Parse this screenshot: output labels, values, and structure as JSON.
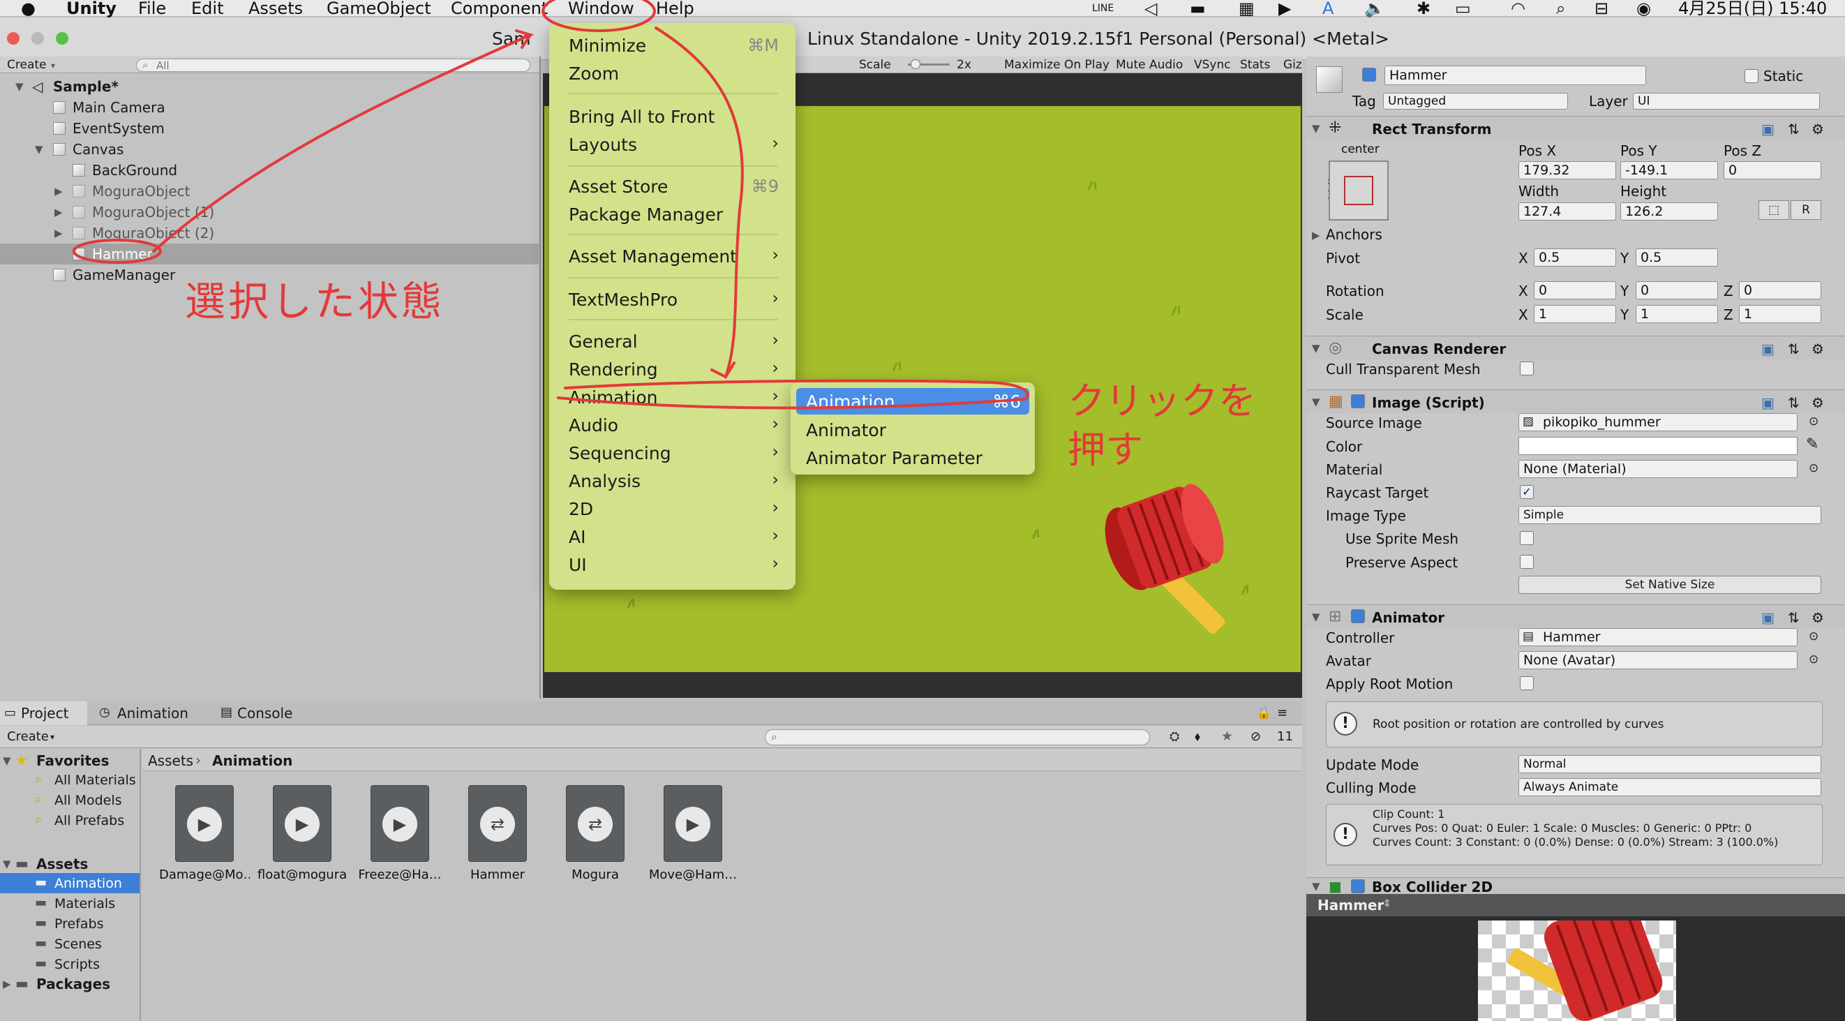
{
  "menubar": {
    "apple": "",
    "app": "Unity",
    "items": [
      "File",
      "Edit",
      "Assets",
      "GameObject",
      "Component",
      "Window",
      "Help"
    ],
    "status_clock": "4月25日(日) 15:40",
    "status_line": "LINE"
  },
  "titlebar": {
    "title": "Linux Standalone - Unity 2019.2.15f1 Personal (Personal) <Metal>",
    "title_prefix": "Sam",
    "amp": "&"
  },
  "hierarchy": {
    "create": "Create",
    "search_placeholder": "All",
    "scene": "Sample*",
    "items": [
      "Main Camera",
      "EventSystem",
      "Canvas",
      "BackGround",
      "MoguraObject",
      "MoguraObject (1)",
      "MoguraObject (2)",
      "Hammer",
      "GameManager"
    ]
  },
  "game_toolbar": {
    "scale_label": "Scale",
    "scale_value": "2x",
    "buttons": [
      "Maximize On Play",
      "Mute Audio",
      "VSync",
      "Stats",
      "Giz"
    ]
  },
  "window_menu": {
    "minimize": "Minimize",
    "minimize_sc": "⌘M",
    "zoom": "Zoom",
    "bring": "Bring All to Front",
    "layouts": "Layouts",
    "asset_store": "Asset Store",
    "asset_store_sc": "⌘9",
    "package_manager": "Package Manager",
    "asset_management": "Asset Management",
    "textmeshpro": "TextMeshPro",
    "general": "General",
    "rendering": "Rendering",
    "animation": "Animation",
    "audio": "Audio",
    "sequencing": "Sequencing",
    "analysis": "Analysis",
    "twod": "2D",
    "ai": "AI",
    "ui": "UI"
  },
  "submenu": {
    "animation": "Animation",
    "animation_sc": "⌘6",
    "animator": "Animator",
    "animator_param": "Animator Parameter"
  },
  "annotations": {
    "selected": "選択した状態",
    "click": "クリックを押す"
  },
  "inspector": {
    "name": "Hammer",
    "static": "Static",
    "tag_label": "Tag",
    "tag": "Untagged",
    "layer_label": "Layer",
    "layer": "UI",
    "rect_transform": "Rect Transform",
    "anchor_h": "center",
    "anchor_v": "middle",
    "posx_l": "Pos X",
    "posy_l": "Pos Y",
    "posz_l": "Pos Z",
    "posx": "179.32",
    "posy": "-149.1",
    "posz": "0",
    "width_l": "Width",
    "height_l": "Height",
    "width": "127.4",
    "height": "126.2",
    "r_btn": "R",
    "anchors": "Anchors",
    "pivot": "Pivot",
    "pivot_x": "0.5",
    "pivot_y": "0.5",
    "rotation": "Rotation",
    "rot_x": "0",
    "rot_y": "0",
    "rot_z": "0",
    "scale": "Scale",
    "sc_x": "1",
    "sc_y": "1",
    "sc_z": "1",
    "x": "X",
    "y": "Y",
    "z": "Z",
    "canvas_renderer": "Canvas Renderer",
    "cull": "Cull Transparent Mesh",
    "image_script": "Image (Script)",
    "source_image_l": "Source Image",
    "source_image": "pikopiko_hummer",
    "color_l": "Color",
    "material_l": "Material",
    "material": "None (Material)",
    "raycast": "Raycast Target",
    "image_type_l": "Image Type",
    "image_type": "Simple",
    "use_sprite_mesh": "Use Sprite Mesh",
    "preserve_aspect": "Preserve Aspect",
    "native_size": "Set Native Size",
    "animator": "Animator",
    "controller_l": "Controller",
    "controller": "Hammer",
    "avatar_l": "Avatar",
    "avatar": "None (Avatar)",
    "apply_root": "Apply Root Motion",
    "root_info": "Root position or rotation are controlled by curves",
    "update_mode_l": "Update Mode",
    "update_mode": "Normal",
    "culling_l": "Culling Mode",
    "culling": "Always Animate",
    "clip1": "Clip Count: 1",
    "clip2": "Curves Pos: 0 Quat: 0 Euler: 1 Scale: 0 Muscles: 0 Generic: 0 PPtr: 0",
    "clip3": "Curves Count: 3 Constant: 0 (0.0%) Dense: 0 (0.0%) Stream: 3 (100.0%)",
    "box_collider": "Box Collider 2D",
    "preview_title": "Hammer"
  },
  "bottom": {
    "tabs": [
      "Project",
      "Animation",
      "Console"
    ],
    "create": "Create",
    "count": "11",
    "favorites": "Favorites",
    "fav_items": [
      "All Materials",
      "All Models",
      "All Prefabs"
    ],
    "assets": "Assets",
    "asset_folders": [
      "Animation",
      "Materials",
      "Prefabs",
      "Scenes",
      "Scripts"
    ],
    "packages": "Packages",
    "breadcrumb_root": "Assets",
    "breadcrumb_current": "Animation",
    "files": [
      {
        "name": "Damage@Mo…",
        "kind": "clip"
      },
      {
        "name": "float@mogura",
        "kind": "clip"
      },
      {
        "name": "Freeze@Ha…",
        "kind": "clip"
      },
      {
        "name": "Hammer",
        "kind": "controller"
      },
      {
        "name": "Mogura",
        "kind": "controller"
      },
      {
        "name": "Move@Ham…",
        "kind": "clip"
      }
    ]
  },
  "colors": {
    "menu_bg": "#d2e28a",
    "highlight": "#4a8ee6",
    "annotation": "#e23a3a",
    "game_bg": "#a6bf28",
    "selection": "#3d7fd6"
  }
}
